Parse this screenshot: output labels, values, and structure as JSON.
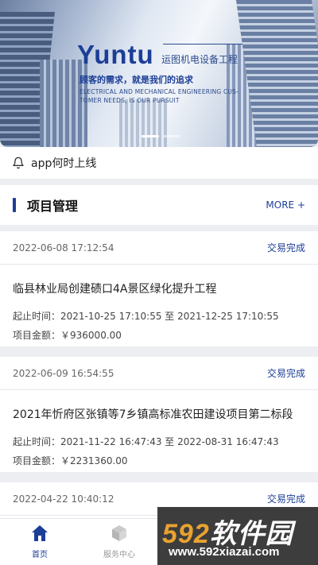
{
  "banner": {
    "brand": "Yuntu",
    "subtitle": "运图机电设备工程",
    "slogan": "顾客的需求，就是我们的追求",
    "english": "ELECTRICAL AND MECHANICAL ENGINEERING CUS-TOMER NEEDS, IS OUR PURSUIT"
  },
  "notice": {
    "icon": "bell-icon",
    "text": "app何时上线"
  },
  "section": {
    "title": "项目管理",
    "more": "MORE +"
  },
  "projects": [
    {
      "date": "2022-06-08 17:12:54",
      "status": "交易完成",
      "name": "临县林业局创建碛口4A景区绿化提升工程",
      "period_label": "起止时间：",
      "start": "2021-10-25 17:10:55",
      "to": "至",
      "end": "2021-12-25 17:10:55",
      "amount_label": "项目金额：",
      "amount": "￥936000.00"
    },
    {
      "date": "2022-06-09 16:54:55",
      "status": "交易完成",
      "name": "2021年忻府区张镇等7乡镇高标准农田建设项目第二标段",
      "period_label": "起止时间：",
      "start": "2021-11-22 16:47:43",
      "to": "至",
      "end": "2022-08-31 16:47:43",
      "amount_label": "项目金额：",
      "amount": "￥2231360.00"
    },
    {
      "date": "2022-04-22 10:40:12",
      "status": "交易完成"
    }
  ],
  "tabbar": {
    "items": [
      {
        "label": "首页",
        "icon": "home-icon",
        "active": true
      },
      {
        "label": "服务中心",
        "icon": "box-icon",
        "active": false
      }
    ]
  },
  "watermark": {
    "brand_digits": "592",
    "brand_text": "软件园",
    "url": "www.592xiazai.com"
  },
  "colors": {
    "accent": "#1c3e97",
    "background": "#eceef1"
  }
}
